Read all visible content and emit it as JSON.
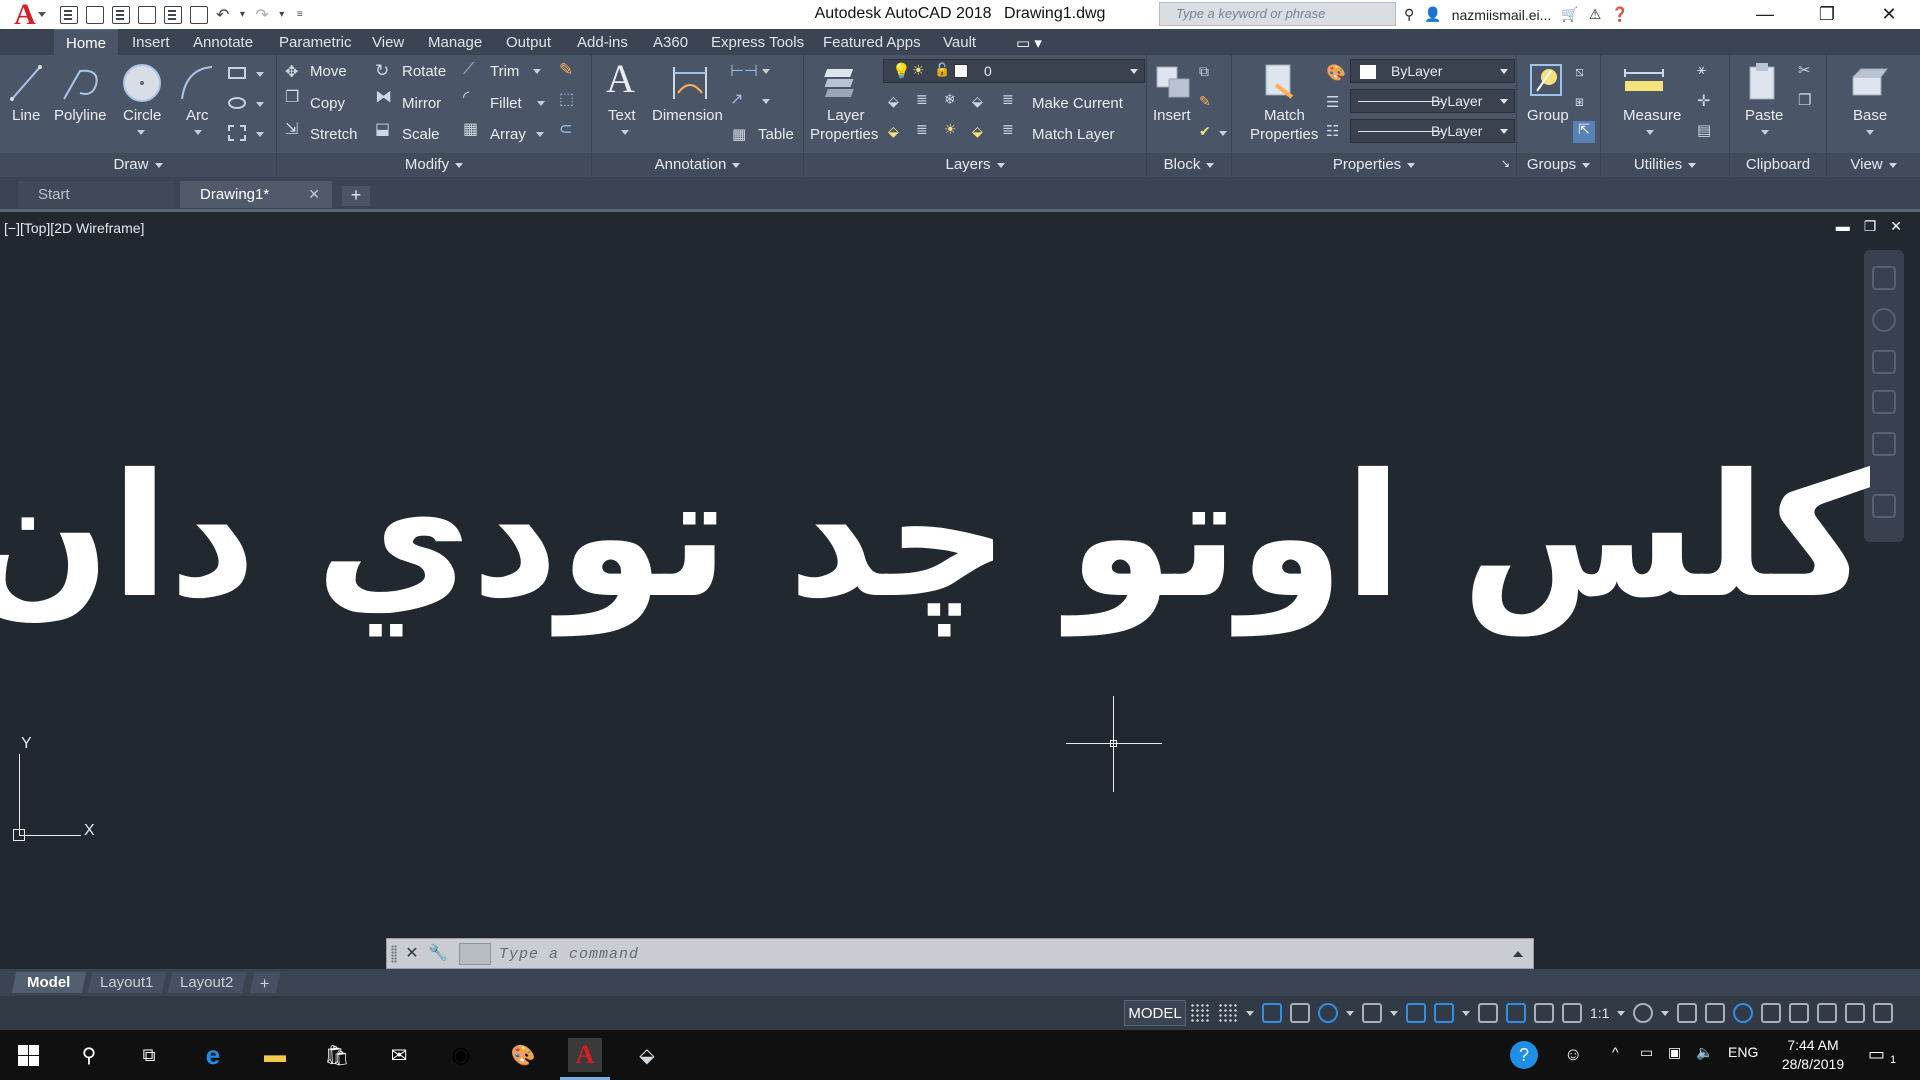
{
  "titlebar": {
    "app_name": "Autodesk AutoCAD 2018",
    "file_name": "Drawing1.dwg",
    "search_placeholder": "Type a keyword or phrase",
    "user_name": "nazmiismail.ei...",
    "logo_letter": "A"
  },
  "ribbon_tabs": [
    "Home",
    "Insert",
    "Annotate",
    "Parametric",
    "View",
    "Manage",
    "Output",
    "Add-ins",
    "A360",
    "Express Tools",
    "Featured Apps",
    "Vault"
  ],
  "ribbon": {
    "draw": {
      "title": "Draw",
      "line": "Line",
      "polyline": "Polyline",
      "circle": "Circle",
      "arc": "Arc"
    },
    "modify": {
      "title": "Modify",
      "move": "Move",
      "rotate": "Rotate",
      "trim": "Trim",
      "copy": "Copy",
      "mirror": "Mirror",
      "fillet": "Fillet",
      "stretch": "Stretch",
      "scale": "Scale",
      "array": "Array"
    },
    "annotation": {
      "title": "Annotation",
      "text": "Text",
      "dimension": "Dimension",
      "table": "Table"
    },
    "layers": {
      "title": "Layers",
      "layer_properties_1": "Layer",
      "layer_properties_2": "Properties",
      "current_layer": "0",
      "make_current": "Make Current",
      "match_layer": "Match Layer"
    },
    "block": {
      "title": "Block",
      "insert": "Insert"
    },
    "properties": {
      "title": "Properties",
      "match_1": "Match",
      "match_2": "Properties",
      "color": "ByLayer",
      "linetype": "ByLayer",
      "lineweight": "ByLayer"
    },
    "groups": {
      "title": "Groups",
      "group": "Group"
    },
    "utilities": {
      "title": "Utilities",
      "measure": "Measure"
    },
    "clipboard": {
      "title": "Clipboard",
      "paste": "Paste"
    },
    "view": {
      "title": "View",
      "base": "Base"
    }
  },
  "file_tabs": {
    "start": "Start",
    "drawing": "Drawing1*"
  },
  "viewport": {
    "label": "[−][Top][2D Wireframe]",
    "drawing_text": "كلس اوتو چد تودي دان تردي",
    "ucs_y": "Y",
    "ucs_x": "X"
  },
  "command_line": {
    "placeholder": "Type a command"
  },
  "layout_tabs": [
    "Model",
    "Layout1",
    "Layout2"
  ],
  "status_bar": {
    "model": "MODEL",
    "scale": "1:1"
  },
  "taskbar": {
    "language": "ENG",
    "time": "7:44 AM",
    "date": "28/8/2019",
    "notification_count": "1"
  },
  "colors": {
    "accent": "#d81e24",
    "canvas": "#212830",
    "ribbon": "#4b5568",
    "blue_tool": "#2f8fe6"
  }
}
